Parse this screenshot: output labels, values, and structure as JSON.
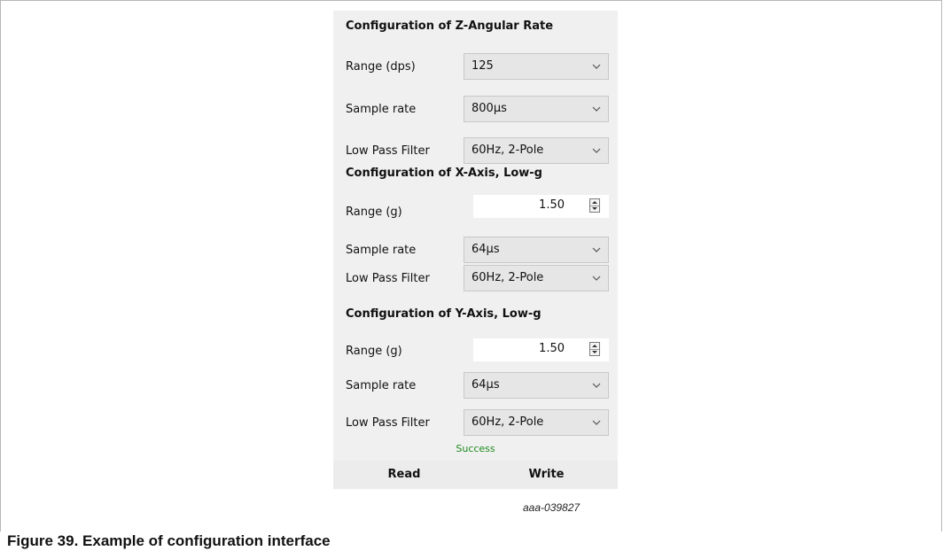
{
  "sections": [
    {
      "title": "Configuration of Z-Angular Rate",
      "rows": [
        {
          "label": "Range (dps)",
          "value": "125",
          "control": "dropdown"
        },
        {
          "label": "Sample rate",
          "value": "800µs",
          "control": "dropdown"
        },
        {
          "label": "Low Pass Filter",
          "value": "60Hz, 2-Pole",
          "control": "dropdown"
        }
      ]
    },
    {
      "title": "Configuration of X-Axis, Low-g",
      "rows": [
        {
          "label": "Range (g)",
          "value": "1.50",
          "control": "spinner"
        },
        {
          "label": "Sample rate",
          "value": "64µs",
          "control": "dropdown"
        },
        {
          "label": "Low Pass Filter",
          "value": "60Hz, 2-Pole",
          "control": "dropdown"
        }
      ]
    },
    {
      "title": "Configuration of Y-Axis, Low-g",
      "rows": [
        {
          "label": "Range (g)",
          "value": "1.50",
          "control": "spinner"
        },
        {
          "label": "Sample rate",
          "value": "64µs",
          "control": "dropdown"
        },
        {
          "label": "Low Pass Filter",
          "value": "60Hz, 2-Pole",
          "control": "dropdown"
        }
      ]
    }
  ],
  "status": "Success",
  "buttons": {
    "read": "Read",
    "write": "Write"
  },
  "image_id": "aaa-039827",
  "caption": "Figure 39.  Example of configuration interface",
  "colors": {
    "status": "#1e8a1e",
    "panel_bg": "#f0f0f0"
  }
}
